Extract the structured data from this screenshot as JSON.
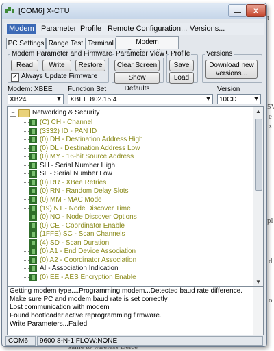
{
  "window": {
    "title": "[COM6] X-CTU",
    "close_glyph": "x"
  },
  "menu": [
    "Modem",
    "Parameter",
    "Profile",
    "Remote Configuration...",
    "Versions..."
  ],
  "tabs": [
    "PC Settings",
    "Range Test",
    "Terminal",
    "Modem Configuration"
  ],
  "groups": {
    "modem_param": {
      "title": "Modem Parameter and Firmware",
      "read": "Read",
      "write": "Write",
      "restore": "Restore",
      "always_update": "Always Update Firmware",
      "always_update_checked": true,
      "check_glyph": "✓"
    },
    "param_view": {
      "title": "Parameter View",
      "clear": "Clear Screen",
      "defaults": "Show Defaults"
    },
    "profile": {
      "title": "Profile",
      "save": "Save",
      "load": "Load"
    },
    "versions": {
      "title": "Versions",
      "download": "Download new\nversions..."
    }
  },
  "selectors": {
    "modem": {
      "label": "Modem: XBEE",
      "value": "XB24"
    },
    "function_set": {
      "label": "Function Set",
      "value": "XBEE 802.15.4"
    },
    "version": {
      "label": "Version",
      "value": "10CD"
    }
  },
  "tree": {
    "root": "Networking & Security",
    "expander": "−",
    "items": [
      {
        "text": "(C) CH - Channel",
        "color": "#8a8a1a"
      },
      {
        "text": "(3332) ID - PAN ID",
        "color": "#8a8a1a"
      },
      {
        "text": "(0) DH - Destination Address High",
        "color": "#8a8a1a"
      },
      {
        "text": "(0) DL - Destination Address Low",
        "color": "#8a8a1a"
      },
      {
        "text": "(0) MY - 16-bit Source Address",
        "color": "#8a8a1a"
      },
      {
        "text": "SH - Serial Number High",
        "color": "#111111"
      },
      {
        "text": "SL - Serial Number Low",
        "color": "#111111"
      },
      {
        "text": "(0) RR - XBee Retries",
        "color": "#8a8a1a"
      },
      {
        "text": "(0) RN - Random Delay Slots",
        "color": "#8a8a1a"
      },
      {
        "text": "(0) MM - MAC Mode",
        "color": "#8a8a1a"
      },
      {
        "text": "(19) NT - Node Discover Time",
        "color": "#8a8a1a"
      },
      {
        "text": "(0) NO - Node Discover Options",
        "color": "#8a8a1a"
      },
      {
        "text": "(0) CE - Coordinator Enable",
        "color": "#8a8a1a"
      },
      {
        "text": "(1FFE) SC - Scan Channels",
        "color": "#8a8a1a"
      },
      {
        "text": "(4) SD - Scan Duration",
        "color": "#8a8a1a"
      },
      {
        "text": "(0) A1 - End Device Association",
        "color": "#8a8a1a"
      },
      {
        "text": "(0) A2 - Coordinator Association",
        "color": "#8a8a1a"
      },
      {
        "text": "AI - Association Indication",
        "color": "#111111"
      },
      {
        "text": "(0) EE - AES Encryption Enable",
        "color": "#8a8a1a"
      }
    ]
  },
  "log": [
    "Getting modem type....Programming modem...Detected baud rate difference.",
    "Make sure PC and modem baud rate is set correctly",
    "Lost communication with modem",
    "Found bootloader active reprogramming firmware.",
    "Write Parameters...Failed"
  ],
  "status": {
    "port": "COM6",
    "settings": "9600 8-N-1  FLOW:NONE"
  },
  "background": {
    "right_fragments": [
      "t",
      "5V",
      "e",
      "x",
      "pl",
      "d",
      "o"
    ],
    "bottom_fragment": "same to   wireless Deice"
  },
  "scroll_glyphs": {
    "up": "▲",
    "down": "▼",
    "dropdown": "▼"
  }
}
